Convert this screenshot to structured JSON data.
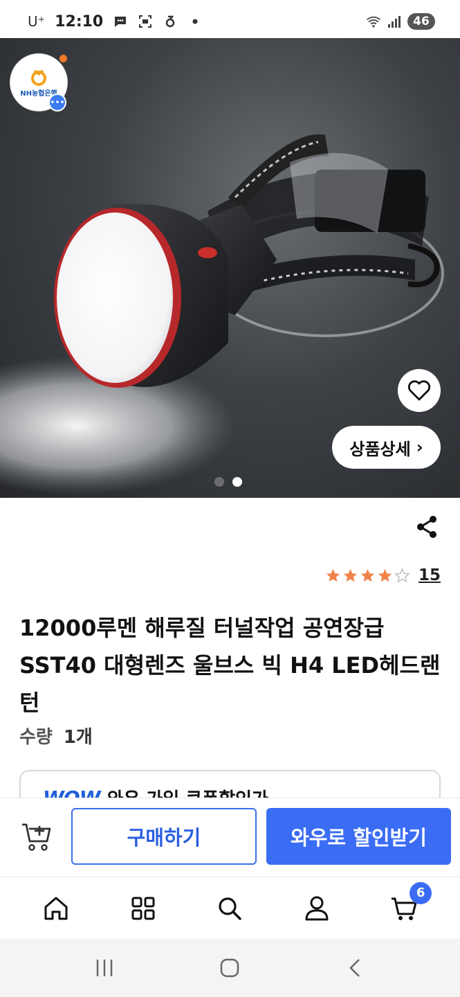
{
  "status_bar": {
    "carrier": "U⁺",
    "time": "12:10",
    "battery": "46"
  },
  "hero": {
    "seller_badge_text": "NH농협은행",
    "detail_button_label": "상품상세",
    "detail_button_chevron": "›",
    "image_count": 2,
    "active_image_index": 1
  },
  "product": {
    "rating": 4,
    "rating_max": 5,
    "review_count": "15",
    "title": "12000루멘 해루질 터널작업 공연장급 SST40 대형렌즈 울브스 빅 H4 LED헤드랜턴",
    "quantity_label": "수량",
    "quantity_value": "1개"
  },
  "coupon": {
    "logo": "WOW",
    "text": "와우 가입 쿠폰할인가"
  },
  "actions": {
    "buy_label": "구매하기",
    "wow_buy_label": "와우로 할인받기"
  },
  "tab_bar": {
    "items": [
      {
        "name": "home",
        "icon": "home-icon"
      },
      {
        "name": "categories",
        "icon": "grid-icon"
      },
      {
        "name": "search",
        "icon": "search-icon"
      },
      {
        "name": "my",
        "icon": "person-icon"
      },
      {
        "name": "cart",
        "icon": "cart-icon"
      }
    ],
    "cart_count": "6"
  },
  "colors": {
    "accent": "#3a6cf4",
    "star": "#f0834a",
    "wow": "#1f5fd8"
  }
}
